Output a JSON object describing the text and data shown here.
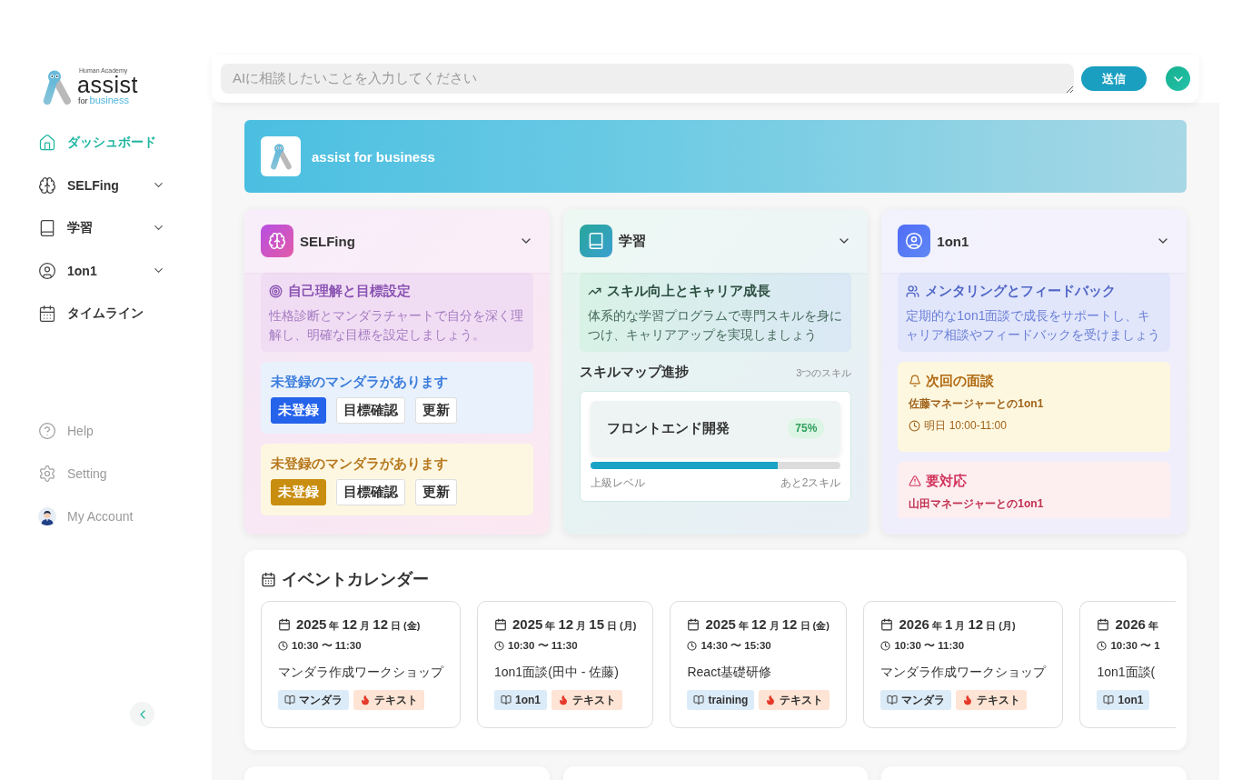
{
  "logo": {
    "maker": "Human Academy",
    "wordmark": "assist",
    "tagline_lead": "for",
    "tagline": "business"
  },
  "nav": [
    {
      "label": "ダッシュボード",
      "kind": "link",
      "selected": true
    },
    {
      "label": "SELFing",
      "kind": "group",
      "selected": false,
      "expanded": false
    },
    {
      "label": "学習",
      "kind": "group",
      "selected": false,
      "expanded": false
    },
    {
      "label": "1on1",
      "kind": "group",
      "selected": false,
      "expanded": false
    },
    {
      "label": "タイムライン",
      "kind": "link",
      "selected": false
    }
  ],
  "utility_nav": [
    {
      "label": "Help"
    },
    {
      "label": "Setting"
    },
    {
      "label": "My Account"
    }
  ],
  "ai_prompt": {
    "placeholder": "AIに相談したいことを入力してください",
    "send_label": "送信"
  },
  "banner": {
    "title": "assist for business"
  },
  "cards": [
    {
      "kind": "selfing",
      "title": "SELFing",
      "expanded": false,
      "intro": {
        "title": "自己理解と目標設定",
        "text": "性格診断とマンダラチャートで自分を深く理解し、明確な目標を設定しましょう。"
      },
      "alerts": [
        {
          "kind": "info",
          "title": "未登録のマンダラがあります",
          "actions": [
            {
              "label": "未登録",
              "kind": "filled"
            },
            {
              "label": "目標確認",
              "kind": "outline"
            },
            {
              "label": "更新",
              "kind": "outline"
            }
          ]
        },
        {
          "kind": "warning",
          "title": "未登録のマンダラがあります",
          "actions": [
            {
              "label": "未登録",
              "kind": "filled"
            },
            {
              "label": "目標確認",
              "kind": "outline"
            },
            {
              "label": "更新",
              "kind": "outline"
            }
          ]
        }
      ]
    },
    {
      "kind": "learning",
      "title": "学習",
      "expanded": false,
      "intro": {
        "title": "スキル向上とキャリア成長",
        "text": "体系的な学習プログラムで専門スキルを身につけ、キャリアアップを実現しましょう"
      },
      "progress": {
        "title": "スキルマップ進捗",
        "count": "3つのスキル",
        "skills": [
          {
            "name": "フロントエンド開発",
            "percent": "75%",
            "level": 0.75,
            "caption": "上級レベル",
            "remaining": "あと2スキル"
          }
        ]
      }
    },
    {
      "kind": "oneonone",
      "title": "1on1",
      "expanded": false,
      "intro": {
        "title": "メンタリングとフィードバック",
        "text": "定期的な1on1面談で成長をサポートし、キャリア相談やフィードバックを受けましょう"
      },
      "notices": [
        {
          "kind": "warning",
          "title": "次回の面談",
          "subtitle": "佐藤マネージャーとの1on1",
          "time": "明日 10:00-11:00"
        },
        {
          "kind": "danger",
          "title": "要対応",
          "subtitle": "山田マネージャーとの1on1"
        }
      ]
    }
  ],
  "calendar": {
    "title": "イベントカレンダー",
    "events": [
      {
        "date": "**2025** 年 **12** 月 **12** 日 (金)",
        "time": "10:30 〜 11:30",
        "title": "マンダラ作成ワークショップ",
        "tags": [
          {
            "kind": "category",
            "label": "マンダラ"
          },
          {
            "kind": "format",
            "label": "テキスト"
          }
        ]
      },
      {
        "date": "**2025** 年 **12** 月 **15** 日 (月)",
        "time": "10:30 〜 11:30",
        "title": "1on1面談(田中 - 佐藤)",
        "tags": [
          {
            "kind": "category",
            "label": "1on1"
          },
          {
            "kind": "format",
            "label": "テキスト"
          }
        ]
      },
      {
        "date": "**2025** 年 **12** 月 **12** 日 (金)",
        "time": "14:30 〜 15:30",
        "title": "React基礎研修",
        "tags": [
          {
            "kind": "category",
            "label": "training"
          },
          {
            "kind": "format",
            "label": "テキスト"
          }
        ]
      },
      {
        "date": "**2026** 年 **1** 月 **12** 日 (月)",
        "time": "10:30 〜 11:30",
        "title": "マンダラ作成ワークショップ",
        "tags": [
          {
            "kind": "category",
            "label": "マンダラ"
          },
          {
            "kind": "format",
            "label": "テキスト"
          }
        ]
      },
      {
        "date": "**2026** 年",
        "time": "10:30 〜 1",
        "title": "1on1面談(",
        "tags": [
          {
            "kind": "category",
            "label": "1on1"
          }
        ]
      }
    ]
  }
}
